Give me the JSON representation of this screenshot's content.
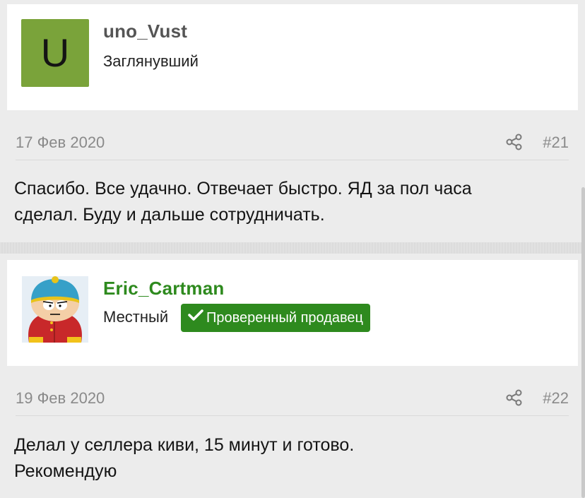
{
  "posts": [
    {
      "user": {
        "avatar_letter": "U",
        "name": "uno_Vust",
        "name_color": "#555555",
        "title": "Заглянувший",
        "avatar_color": "#7aa33a"
      },
      "date": "17 Фев 2020",
      "number": "#21",
      "message_lines": [
        "Спасибо. Все удачно. Отвечает быстро. ЯД за пол часа",
        "сделал. Буду и дальше сотрудничать."
      ]
    },
    {
      "user": {
        "name": "Eric_Cartman",
        "name_color": "#2e8a1e",
        "title": "Местный",
        "badge": "Проверенный продавец",
        "badge_color": "#2e8a1e"
      },
      "date": "19 Фев 2020",
      "number": "#22",
      "message_lines": [
        "Делал у селлера киви, 15 минут и готово.",
        "Рекомендую"
      ]
    }
  ],
  "icons": {
    "share": "share-icon",
    "check": "checkmark-icon"
  }
}
